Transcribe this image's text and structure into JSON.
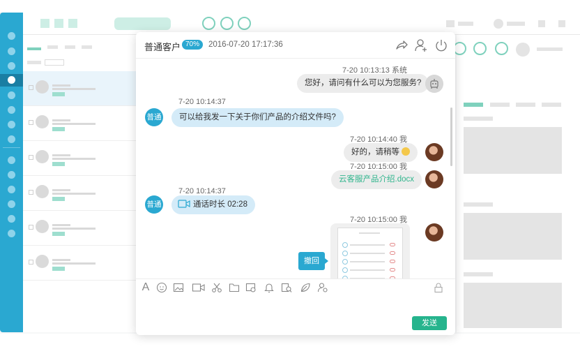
{
  "chat": {
    "customer_name": "普通客户",
    "badge": "70%",
    "datetime": "2016-07-20 17:17:36",
    "messages": [
      {
        "meta": "7-20  10:13:13  系统",
        "text": "您好，请问有什么可以为您服务?"
      },
      {
        "meta": "7-20  10:14:37",
        "tag": "普通",
        "text": "可以给我发一下关于你们产品的介绍文件吗?"
      },
      {
        "meta": "7-20  10:14:40  我",
        "text": "好的，请稍等"
      },
      {
        "meta": "7-20  10:15:00  我",
        "text": "云客服产品介绍.docx"
      },
      {
        "meta": "7-20  10:14:37",
        "tag": "普通",
        "text": "通话时长  02:28"
      },
      {
        "meta": "7-20  10:15:00  我",
        "recall": "撤回"
      }
    ],
    "send_label": "发送"
  },
  "icons": {
    "header": [
      "share-icon",
      "add-user-icon",
      "power-icon"
    ],
    "toolbar": [
      "font-icon",
      "emoji-icon",
      "image-icon",
      "video-icon",
      "scissors-icon",
      "folder-icon",
      "screenshot-icon",
      "bell-icon",
      "book-icon",
      "leaf-icon",
      "user-settings-icon",
      "lock-icon"
    ]
  },
  "colors": {
    "accent": "#2aa8d1",
    "send": "#26b48d",
    "file_link": "#31b58d"
  }
}
